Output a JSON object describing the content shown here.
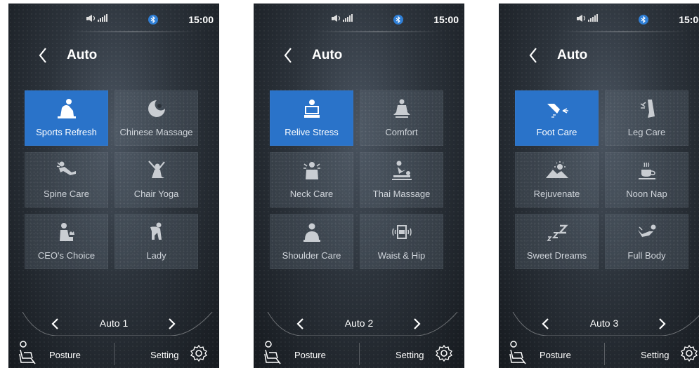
{
  "screens": [
    {
      "status": {
        "time": "15:00"
      },
      "header": {
        "title": "Auto"
      },
      "tiles": [
        {
          "label": "Sports Refresh",
          "icon": "sports-refresh-icon",
          "active": true
        },
        {
          "label": "Chinese Massage",
          "icon": "chinese-massage-icon",
          "active": false
        },
        {
          "label": "Spine Care",
          "icon": "spine-care-icon",
          "active": false
        },
        {
          "label": "Chair Yoga",
          "icon": "chair-yoga-icon",
          "active": false
        },
        {
          "label": "CEO's Choice",
          "icon": "ceo-choice-icon",
          "active": false
        },
        {
          "label": "Lady",
          "icon": "lady-icon",
          "active": false
        }
      ],
      "pager": {
        "label": "Auto 1"
      },
      "footer": {
        "posture": "Posture",
        "setting": "Setting"
      }
    },
    {
      "status": {
        "time": "15:00"
      },
      "header": {
        "title": "Auto"
      },
      "tiles": [
        {
          "label": "Relive Stress",
          "icon": "relive-stress-icon",
          "active": true
        },
        {
          "label": "Comfort",
          "icon": "comfort-icon",
          "active": false
        },
        {
          "label": "Neck Care",
          "icon": "neck-care-icon",
          "active": false
        },
        {
          "label": "Thai Massage",
          "icon": "thai-massage-icon",
          "active": false
        },
        {
          "label": "Shoulder Care",
          "icon": "shoulder-care-icon",
          "active": false
        },
        {
          "label": "Waist & Hip",
          "icon": "waist-hip-icon",
          "active": false
        }
      ],
      "pager": {
        "label": "Auto 2"
      },
      "footer": {
        "posture": "Posture",
        "setting": "Setting"
      }
    },
    {
      "status": {
        "time": "15:00"
      },
      "header": {
        "title": "Auto"
      },
      "tiles": [
        {
          "label": "Foot Care",
          "icon": "foot-care-icon",
          "active": true
        },
        {
          "label": "Leg Care",
          "icon": "leg-care-icon",
          "active": false
        },
        {
          "label": "Rejuvenate",
          "icon": "rejuvenate-icon",
          "active": false
        },
        {
          "label": "Noon Nap",
          "icon": "noon-nap-icon",
          "active": false
        },
        {
          "label": "Sweet Dreams",
          "icon": "sweet-dreams-icon",
          "active": false
        },
        {
          "label": "Full Body",
          "icon": "full-body-icon",
          "active": false
        }
      ],
      "pager": {
        "label": "Auto 3"
      },
      "footer": {
        "posture": "Posture",
        "setting": "Setting"
      }
    }
  ],
  "colors": {
    "accent": "#2a73c9",
    "bluetooth": "#2f7fd6",
    "text": "#ffffff",
    "muted": "#cfd4da"
  }
}
